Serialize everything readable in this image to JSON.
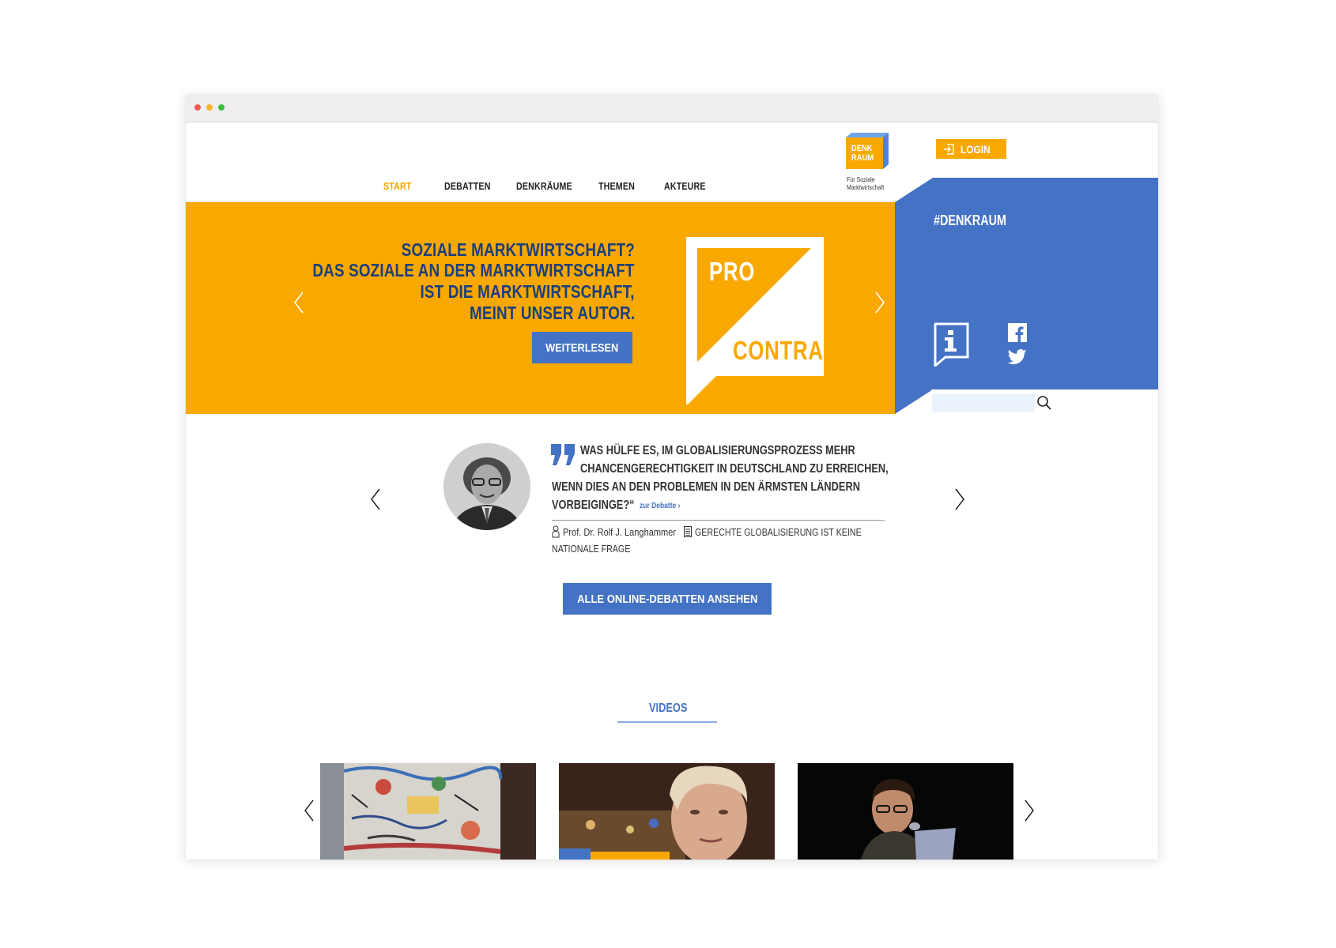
{
  "nav": {
    "items": [
      {
        "label": "START",
        "active": true
      },
      {
        "label": "DEBATTEN",
        "active": false
      },
      {
        "label": "DENKRÄUME",
        "active": false
      },
      {
        "label": "THEMEN",
        "active": false
      },
      {
        "label": "AKTEURE",
        "active": false
      }
    ]
  },
  "logo": {
    "line1": "DENK",
    "line2": "RAUM",
    "subtitle1": "Für Soziale",
    "subtitle2": "Marktwirtschaft"
  },
  "login": {
    "label": "LOGIN"
  },
  "hero": {
    "headline": [
      "SOZIALE MARKTWIRTSCHAFT?",
      "DAS SOZIALE AN DER MARKTWIRTSCHAFT",
      "IST DIE MARKTWIRTSCHAFT,",
      "MEINT UNSER AUTOR."
    ],
    "button": "WEITERLESEN",
    "badge_pro": "PRO",
    "badge_contra": "CONTRA"
  },
  "sidebar": {
    "hashtag": "#DENKRAUM",
    "search_placeholder": ""
  },
  "quote": {
    "lines": [
      "WAS HÜLFE ES, IM GLOBALISIERUNGSPROZESS MEHR",
      "CHANCENGERECHTIGKEIT IN DEUTSCHLAND ZU ERREICHEN,",
      "WENN DIES AN DEN PROBLEMEN IN DEN ÄRMSTEN LÄNDERN",
      "VORBEIGINGE?“"
    ],
    "link": "zur Debatte ›",
    "author": "Prof. Dr. Rolf J. Langhammer",
    "article_line1": "GERECHTE GLOBALISIERUNG IST KEINE",
    "article_line2": "NATIONALE FRAGE"
  },
  "debates_button": "ALLE ONLINE-DEBATTEN ANSEHEN",
  "videos": {
    "heading": "VIDEOS"
  },
  "colors": {
    "orange": "#f9a800",
    "blue": "#4472c4",
    "navy": "#1c3f7c"
  }
}
